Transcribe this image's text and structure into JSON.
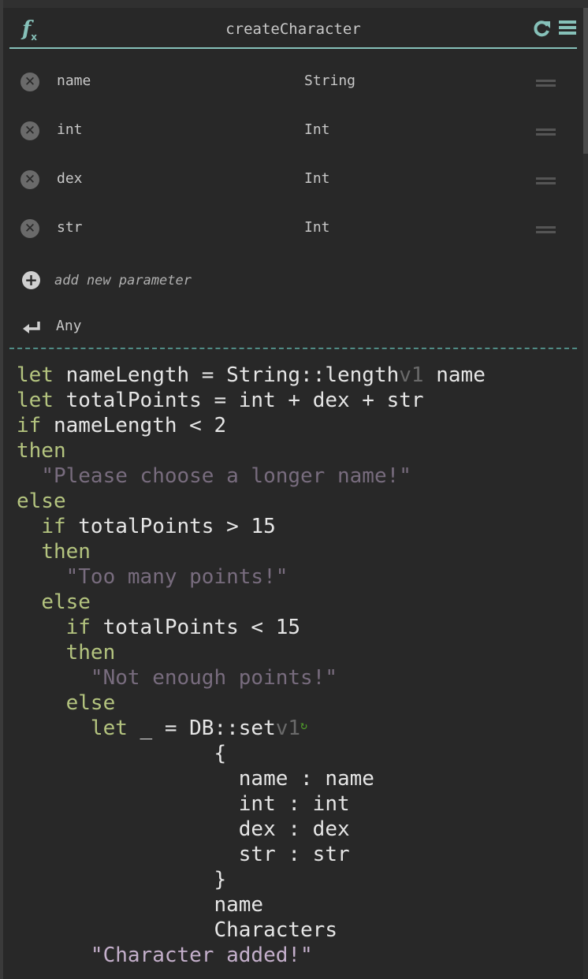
{
  "function": {
    "name": "createCharacter",
    "icon": "fx-icon",
    "actions": [
      {
        "name": "refresh-icon"
      },
      {
        "name": "menu-icon"
      }
    ]
  },
  "parameters": [
    {
      "name": "name",
      "type": "String"
    },
    {
      "name": "int",
      "type": "Int"
    },
    {
      "name": "dex",
      "type": "Int"
    },
    {
      "name": "str",
      "type": "Int"
    }
  ],
  "add_parameter_label": "add new parameter",
  "return_type": "Any",
  "colors": {
    "accent": "#86c1b9",
    "keyword": "#b4c47f",
    "string_active": "#c4afcb",
    "string_inactive": "#786c7e",
    "version": "#6a6a6a",
    "db_icon": "#4e9a2a",
    "text": "#e6e6e6",
    "background": "#282828"
  },
  "code": {
    "l1": {
      "kw": "let",
      "a": " nameLength = String::length",
      "ver": "v1",
      "b": " name"
    },
    "l2": {
      "kw": "let",
      "a": " totalPoints = int + dex + str"
    },
    "l3": {
      "kw": "if",
      "a": " nameLength < 2"
    },
    "l4": {
      "kw": "then"
    },
    "l5": {
      "indent": "  ",
      "str": "\"Please choose a longer name!\""
    },
    "l6": {
      "kw": "else"
    },
    "l7": {
      "indent": "  ",
      "kw": "if",
      "a": " totalPoints > 15"
    },
    "l8": {
      "indent": "  ",
      "kw": "then"
    },
    "l9": {
      "indent": "    ",
      "str": "\"Too many points!\""
    },
    "l10": {
      "indent": "  ",
      "kw": "else"
    },
    "l11": {
      "indent": "    ",
      "kw": "if",
      "a": " totalPoints < 15"
    },
    "l12": {
      "indent": "    ",
      "kw": "then"
    },
    "l13": {
      "indent": "      ",
      "str": "\"Not enough points!\""
    },
    "l14": {
      "indent": "    ",
      "kw": "else"
    },
    "l15": {
      "indent": "      ",
      "kw": "let",
      "a": " _ = DB::set",
      "ver": "v1",
      "icon": "↻"
    },
    "l16": {
      "a": "                {"
    },
    "l17": {
      "a": "                  name : name"
    },
    "l18": {
      "a": "                  int : int"
    },
    "l19": {
      "a": "                  dex : dex"
    },
    "l20": {
      "a": "                  str : str"
    },
    "l21": {
      "a": "                }"
    },
    "l22": {
      "a": "                name"
    },
    "l23": {
      "a": "                Characters"
    },
    "l24": {
      "indent": "      ",
      "str": "\"Character added!\""
    }
  }
}
